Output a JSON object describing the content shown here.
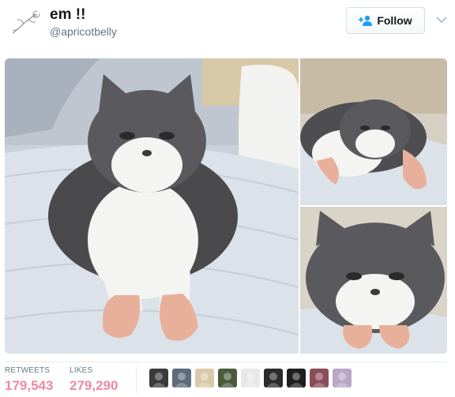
{
  "tweet": {
    "display_name": "em !!",
    "handle": "@apricotbelly",
    "follow_label": "Follow"
  },
  "stats": {
    "retweets_label": "RETWEETS",
    "retweets_count": "179,543",
    "likes_label": "LIKES",
    "likes_count": "279,290"
  },
  "colors": {
    "accent": "#1da1f2",
    "stat_count": "#ef8aa1",
    "muted": "#657786"
  },
  "icons": {
    "follow": "add-person-icon",
    "menu": "chevron-down-icon"
  },
  "liker_avatar_colors": [
    "#3b3b3b",
    "#5d6b7a",
    "#d9c9a8",
    "#4a5a3c",
    "#e8e8e8",
    "#2c2c2c",
    "#1f1f1f",
    "#8a4d5a",
    "#b9a6c8"
  ]
}
